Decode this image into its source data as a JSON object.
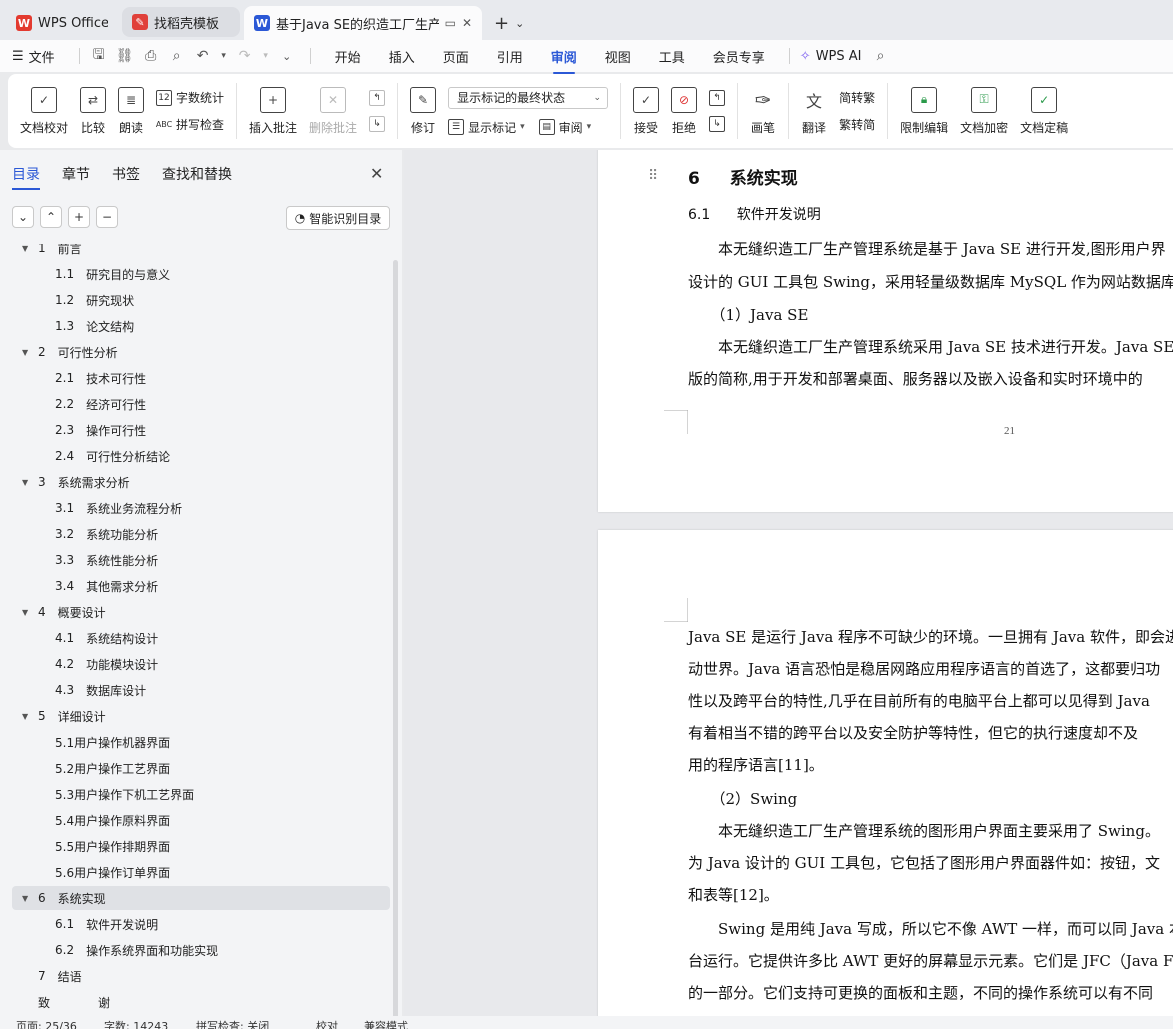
{
  "tabs": [
    {
      "label": "WPS Office",
      "icon": "wps-logo-icon",
      "color": "#e33a2f"
    },
    {
      "label": "找稻壳模板",
      "icon": "daoke-logo-icon",
      "color": "#e0403a"
    },
    {
      "label": "基于Java SE的织造工厂生产管",
      "icon": "writer-doc-icon",
      "color": "#2b58d6"
    }
  ],
  "menubar": {
    "file": "文件",
    "tabs": [
      "开始",
      "插入",
      "页面",
      "引用",
      "审阅",
      "视图",
      "工具",
      "会员专享"
    ],
    "active": "审阅",
    "ai": "WPS AI"
  },
  "ribbon": {
    "doc_check": "文档校对",
    "compare": "比较",
    "read_aloud": "朗读",
    "word_count": "字数统计",
    "spell_check": "拼写检查",
    "insert_comment": "插入批注",
    "delete_comment": "删除批注",
    "track_changes": "修订",
    "display_mode": "显示标记的最终状态",
    "show_markup": "显示标记",
    "review": "审阅",
    "accept": "接受",
    "reject": "拒绝",
    "pen": "画笔",
    "translate": "翻译",
    "to_traditional": "简转繁",
    "to_simplified": "繁转简",
    "restrict_edit": "限制编辑",
    "encrypt": "文档加密",
    "finalize": "文档定稿"
  },
  "nav": {
    "tabs": [
      "目录",
      "章节",
      "书签",
      "查找和替换"
    ],
    "active": "目录",
    "smart_btn": "智能识别目录",
    "toc": [
      {
        "num": "1",
        "text": "前言",
        "level": 1,
        "expanded": true
      },
      {
        "num": "1.1",
        "text": "研究目的与意义",
        "level": 2
      },
      {
        "num": "1.2",
        "text": "研究现状",
        "level": 2
      },
      {
        "num": "1.3",
        "text": "论文结构",
        "level": 2
      },
      {
        "num": "2",
        "text": "可行性分析",
        "level": 1,
        "expanded": true
      },
      {
        "num": "2.1",
        "text": "技术可行性",
        "level": 2
      },
      {
        "num": "2.2",
        "text": "经济可行性",
        "level": 2
      },
      {
        "num": "2.3",
        "text": "操作可行性",
        "level": 2
      },
      {
        "num": "2.4",
        "text": "可行性分析结论",
        "level": 2
      },
      {
        "num": "3",
        "text": "系统需求分析",
        "level": 1,
        "expanded": true
      },
      {
        "num": "3.1",
        "text": "系统业务流程分析",
        "level": 2
      },
      {
        "num": "3.2",
        "text": "系统功能分析",
        "level": 2
      },
      {
        "num": "3.3",
        "text": "系统性能分析",
        "level": 2
      },
      {
        "num": "3.4",
        "text": "其他需求分析",
        "level": 2
      },
      {
        "num": "4",
        "text": "概要设计",
        "level": 1,
        "expanded": true
      },
      {
        "num": "4.1",
        "text": "系统结构设计",
        "level": 2
      },
      {
        "num": "4.2",
        "text": "功能模块设计",
        "level": 2
      },
      {
        "num": "4.3",
        "text": "数据库设计",
        "level": 2
      },
      {
        "num": "5",
        "text": "详细设计",
        "level": 1,
        "expanded": true
      },
      {
        "num": "",
        "text": "5.1用户操作机器界面",
        "level": 2
      },
      {
        "num": "",
        "text": "5.2用户操作工艺界面",
        "level": 2
      },
      {
        "num": "",
        "text": "5.3用户操作下机工艺界面",
        "level": 2
      },
      {
        "num": "",
        "text": "5.4用户操作原料界面",
        "level": 2
      },
      {
        "num": "",
        "text": "5.5用户操作排期界面",
        "level": 2
      },
      {
        "num": "",
        "text": "5.6用户操作订单界面",
        "level": 2
      },
      {
        "num": "6",
        "text": "系统实现",
        "level": 1,
        "expanded": true,
        "selected": true
      },
      {
        "num": "6.1",
        "text": "软件开发说明",
        "level": 2
      },
      {
        "num": "6.2",
        "text": "操作系统界面和功能实现",
        "level": 2
      },
      {
        "num": "7",
        "text": "结语",
        "level": 1
      },
      {
        "num": "致",
        "text": "谢",
        "level": 1
      }
    ]
  },
  "status": {
    "page": "页面: 25/36",
    "words": "字数: 14243",
    "spell": "拼写检查: 关闭",
    "proof": "校对",
    "compat": "兼容模式"
  },
  "doc": {
    "page1": {
      "h1_num": "6",
      "h1_text": "系统实现",
      "h2_num": "6.1",
      "h2_text": "软件开发说明",
      "lines": [
        "　　本无缝织造工厂生产管理系统是基于 Java SE 进行开发,图形用户界",
        "设计的 GUI 工具包 Swing，采用轻量级数据库 MySQL 作为网站数据库",
        "　　（1）Java SE",
        "　　本无缝织造工厂生产管理系统采用 Java SE 技术进行开发。Java SE",
        "版的简称,用于开发和部署桌面、服务器以及嵌入设备和实时环境中的"
      ],
      "page_number": "21"
    },
    "page2": {
      "lines": [
        "Java SE 是运行 Java 程序不可缺少的环境。一旦拥有 Java 软件，即会进",
        "动世界。Java 语言恐怕是稳居网路应用程序语言的首选了，这都要归功",
        "性以及跨平台的特性,几乎在目前所有的电脑平台上都可以见得到 Java",
        "有着相当不错的跨平台以及安全防护等特性，但它的执行速度却不及",
        "用的程序语言[11]。",
        "　　（2）Swing",
        "　　本无缝织造工厂生产管理系统的图形用户界面主要采用了 Swing。",
        "为 Java 设计的 GUI 工具包，它包括了图形用户界面器件如：按钮，文",
        "和表等[12]。",
        "　　Swing 是用纯 Java 写成，所以它不像 AWT 一样，而可以同 Java 本",
        "台运行。它提供许多比 AWT 更好的屏幕显示元素。它们是 JFC（Java F",
        "的一部分。它们支持可更换的面板和主题，不同的操作系统可以有不同"
      ]
    }
  }
}
